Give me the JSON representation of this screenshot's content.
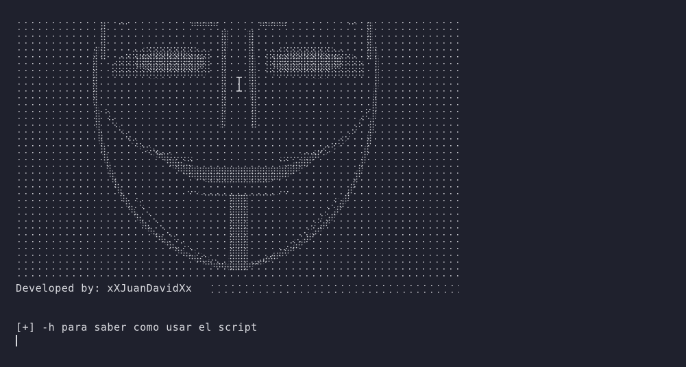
{
  "terminal": {
    "banner_credit": "Developed by: xXJuanDavidXx",
    "help_prefix": "[+]",
    "help_message": "-h para saber como usar el script",
    "ascii_art_subject": "guy-fawkes-mask",
    "colors": {
      "background": "#1f212d",
      "text": "#d8d9de"
    },
    "icons": {
      "pointer": "text-ibeam-cursor-icon",
      "caret": "terminal-caret"
    }
  }
}
